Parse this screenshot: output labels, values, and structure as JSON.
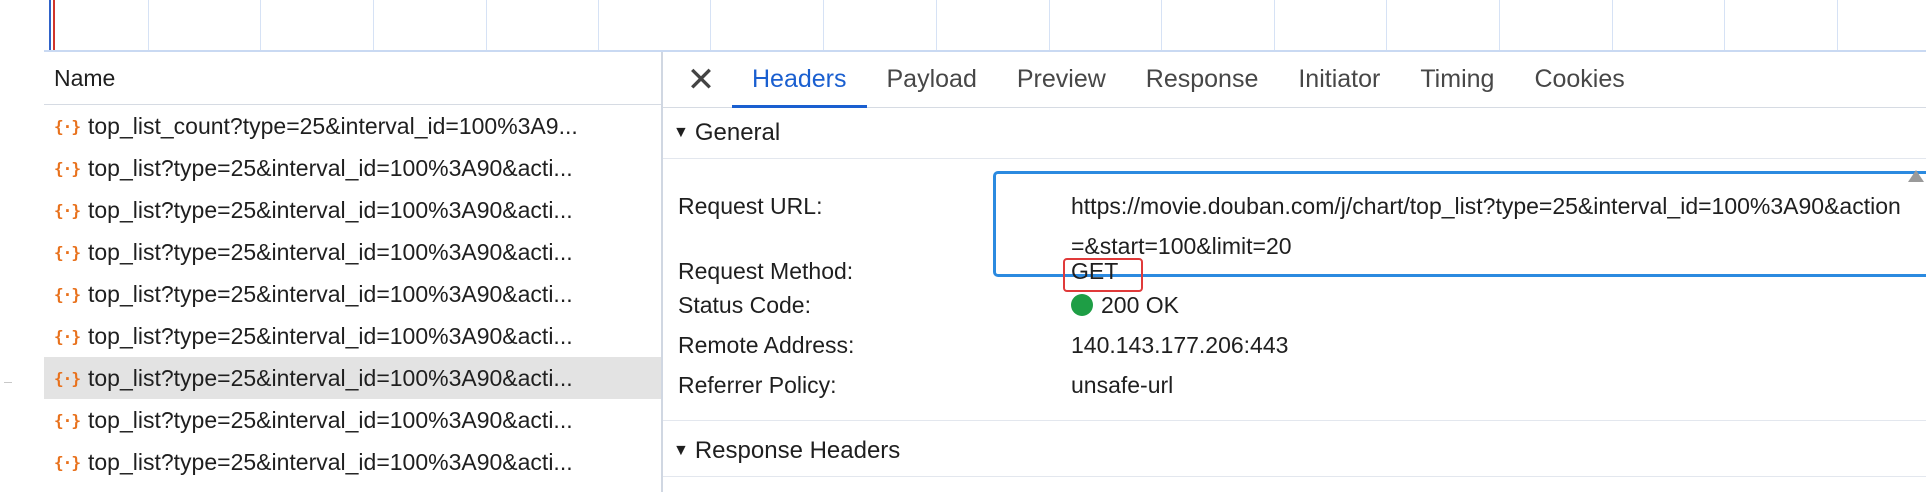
{
  "name_panel": {
    "header": "Name",
    "requests": [
      {
        "name": "top_list_count?type=25&interval_id=100%3A9...",
        "selected": false
      },
      {
        "name": "top_list?type=25&interval_id=100%3A90&acti...",
        "selected": false
      },
      {
        "name": "top_list?type=25&interval_id=100%3A90&acti...",
        "selected": false
      },
      {
        "name": "top_list?type=25&interval_id=100%3A90&acti...",
        "selected": false
      },
      {
        "name": "top_list?type=25&interval_id=100%3A90&acti...",
        "selected": false
      },
      {
        "name": "top_list?type=25&interval_id=100%3A90&acti...",
        "selected": false
      },
      {
        "name": "top_list?type=25&interval_id=100%3A90&acti...",
        "selected": true
      },
      {
        "name": "top_list?type=25&interval_id=100%3A90&acti...",
        "selected": false
      },
      {
        "name": "top_list?type=25&interval_id=100%3A90&acti...",
        "selected": false
      }
    ],
    "request_icon": "fetch-xhr-icon"
  },
  "details": {
    "close_icon": "close-icon",
    "tabs": [
      "Headers",
      "Payload",
      "Preview",
      "Response",
      "Initiator",
      "Timing",
      "Cookies"
    ],
    "active_tab": "Headers",
    "general": {
      "title": "General",
      "request_url_label": "Request URL:",
      "request_url": "https://movie.douban.com/j/chart/top_list?type=25&interval_id=100%3A90&action=&start=100&limit=20",
      "request_method_label": "Request Method:",
      "request_method": "GET",
      "status_code_label": "Status Code:",
      "status_code": "200 OK",
      "status_color": "#1e9e45",
      "remote_address_label": "Remote Address:",
      "remote_address": "140.143.177.206:443",
      "referrer_policy_label": "Referrer Policy:",
      "referrer_policy": "unsafe-url"
    },
    "response_headers_title": "Response Headers"
  },
  "colors": {
    "accent": "#1a5fd0",
    "highlight_blue": "#2b8ae0",
    "highlight_red": "#e03a3a",
    "xhr_icon": "#e8711c",
    "selected_row": "#e3e3e3"
  }
}
